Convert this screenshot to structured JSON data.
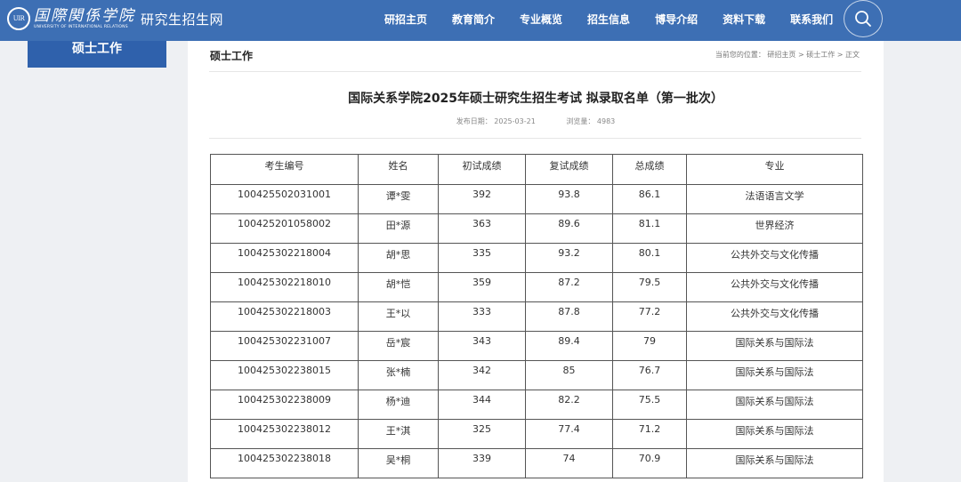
{
  "header": {
    "logo_seal": "UIR",
    "logo_name": "国際関係学院",
    "logo_en": "UNIVERSITY OF INTERNATIONAL RELATIONS",
    "site_name": "研究生招生网",
    "nav": [
      "研招主页",
      "教育简介",
      "专业概览",
      "招生信息",
      "博导介绍",
      "资料下载",
      "联系我们"
    ],
    "search_icon": "search-icon"
  },
  "sidebar": {
    "title": "硕士工作"
  },
  "section": {
    "title": "硕士工作",
    "breadcrumb": "当前您的位置：  研招主页 > 硕士工作 > 正文"
  },
  "article": {
    "title": "国际关系学院2025年硕士研究生招生考试 拟录取名单（第一批次）",
    "publish_date": "发布日期：  2025-03-21",
    "views": "浏览量：  4983"
  },
  "table": {
    "headers": [
      "考生编号",
      "姓名",
      "初试成绩",
      "复试成绩",
      "总成绩",
      "专业"
    ],
    "rows": [
      [
        "100425502031001",
        "谭*雯",
        "392",
        "93.8",
        "86.1",
        "法语语言文学"
      ],
      [
        "100425201058002",
        "田*源",
        "363",
        "89.6",
        "81.1",
        "世界经济"
      ],
      [
        "100425302218004",
        "胡*思",
        "335",
        "93.2",
        "80.1",
        "公共外交与文化传播"
      ],
      [
        "100425302218010",
        "胡*恺",
        "359",
        "87.2",
        "79.5",
        "公共外交与文化传播"
      ],
      [
        "100425302218003",
        "王*以",
        "333",
        "87.8",
        "77.2",
        "公共外交与文化传播"
      ],
      [
        "100425302231007",
        "岳*宸",
        "343",
        "89.4",
        "79",
        "国际关系与国际法"
      ],
      [
        "100425302238015",
        "张*楠",
        "342",
        "85",
        "76.7",
        "国际关系与国际法"
      ],
      [
        "100425302238009",
        "杨*迪",
        "344",
        "82.2",
        "75.5",
        "国际关系与国际法"
      ],
      [
        "100425302238012",
        "王*淇",
        "325",
        "77.4",
        "71.2",
        "国际关系与国际法"
      ],
      [
        "100425302238018",
        "吴*桐",
        "339",
        "74",
        "70.9",
        "国际关系与国际法"
      ]
    ]
  }
}
